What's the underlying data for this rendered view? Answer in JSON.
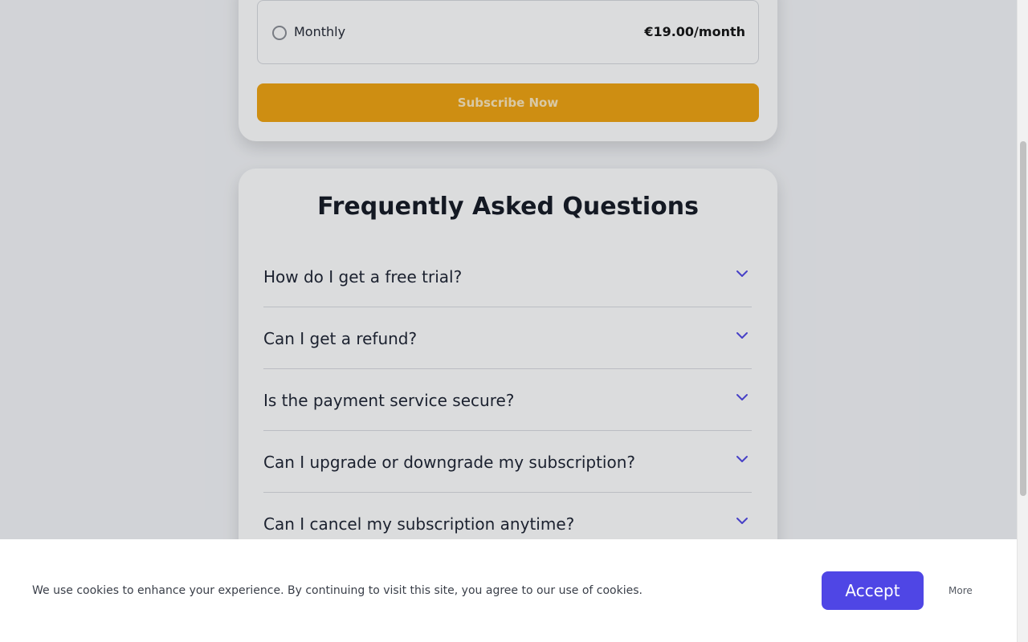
{
  "plan": {
    "option_label": "Monthly",
    "option_price": "€19.00/month",
    "subscribe_label": "Subscribe Now"
  },
  "faq": {
    "title": "Frequently Asked Questions",
    "items": [
      {
        "question": "How do I get a free trial?"
      },
      {
        "question": "Can I get a refund?"
      },
      {
        "question": "Is the payment service secure?"
      },
      {
        "question": "Can I upgrade or downgrade my subscription?"
      },
      {
        "question": "Can I cancel my subscription anytime?"
      }
    ],
    "icon": "chevron-down-icon"
  },
  "cookie": {
    "message": "We use cookies to enhance your experience. By continuing to visit this site, you agree to our use of cookies.",
    "accept_label": "Accept",
    "more_label": "More"
  },
  "colors": {
    "accent": "#4f46e5",
    "subscribe": "#f0a20e"
  }
}
